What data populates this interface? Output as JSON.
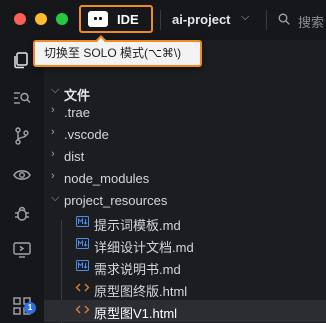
{
  "titlebar": {
    "mode_label": "IDE",
    "project_name": "ai-project",
    "search_label": "搜索"
  },
  "tooltip": {
    "text": "切换至 SOLO 模式(⌥⌘\\)"
  },
  "activity": {
    "badge_count": "1"
  },
  "explorer": {
    "section_title": "文件",
    "folders": [
      ".trae",
      ".vscode",
      "dist",
      "node_modules"
    ],
    "expanded_folder": "project_resources",
    "files": [
      {
        "name": "提示词模板.md",
        "type": "md"
      },
      {
        "name": "详细设计文档.md",
        "type": "md"
      },
      {
        "name": "需求说明书.md",
        "type": "md"
      },
      {
        "name": "原型图终版.html",
        "type": "html"
      },
      {
        "name": "原型图V1.html",
        "type": "html"
      }
    ]
  },
  "colors": {
    "highlight": "#f08a24",
    "md_icon": "#4f8be8",
    "html_icon": "#d97c3b",
    "badge": "#2f6fe0"
  }
}
